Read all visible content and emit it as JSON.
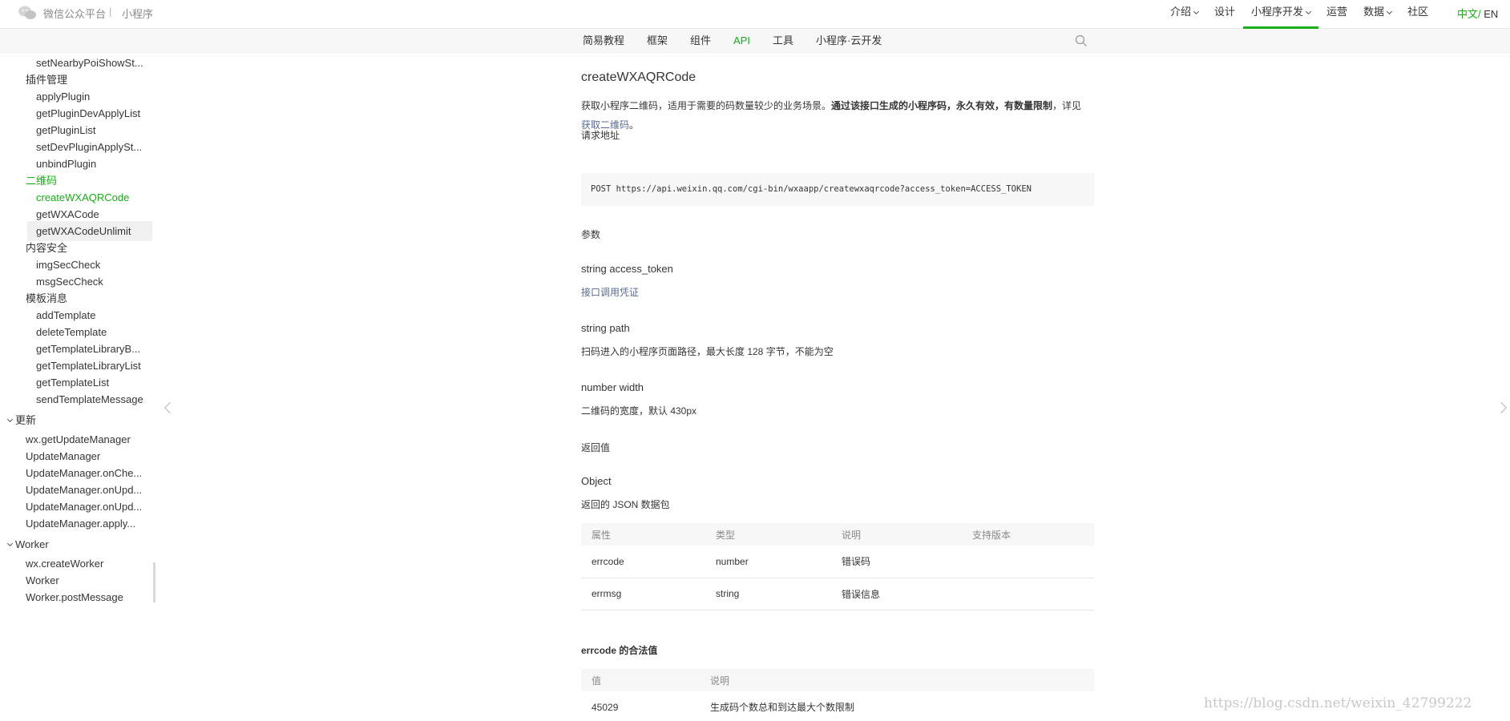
{
  "header": {
    "brand": "微信公众平台",
    "separator": "|",
    "sub_brand": "小程序",
    "nav": [
      {
        "label": "介绍",
        "dropdown": true
      },
      {
        "label": "设计",
        "dropdown": false
      },
      {
        "label": "小程序开发",
        "dropdown": true,
        "active": true
      },
      {
        "label": "运营",
        "dropdown": false
      },
      {
        "label": "数据",
        "dropdown": true
      },
      {
        "label": "社区",
        "dropdown": false
      }
    ],
    "lang_zh": "中文",
    "lang_sep": "/",
    "lang_en": "EN",
    "accent_color": "#1aad19"
  },
  "subnav": {
    "tabs": [
      "简易教程",
      "框架",
      "组件",
      "API",
      "工具",
      "小程序·云开发"
    ],
    "active_tab": "API"
  },
  "sidebar": {
    "items": [
      {
        "label": "setNearbyPoiShowSt...",
        "level": 3
      },
      {
        "label": "插件管理",
        "level": 2
      },
      {
        "label": "applyPlugin",
        "level": 3
      },
      {
        "label": "getPluginDevApplyList",
        "level": 3
      },
      {
        "label": "getPluginList",
        "level": 3
      },
      {
        "label": "setDevPluginApplySt...",
        "level": 3
      },
      {
        "label": "unbindPlugin",
        "level": 3
      },
      {
        "label": "二维码",
        "level": 2,
        "green": true
      },
      {
        "label": "createWXAQRCode",
        "level": 3,
        "green": true
      },
      {
        "label": "getWXACode",
        "level": 3
      },
      {
        "label": "getWXACodeUnlimit",
        "level": 3,
        "selected": true
      },
      {
        "label": "内容安全",
        "level": 2
      },
      {
        "label": "imgSecCheck",
        "level": 3
      },
      {
        "label": "msgSecCheck",
        "level": 3
      },
      {
        "label": "模板消息",
        "level": 2
      },
      {
        "label": "addTemplate",
        "level": 3
      },
      {
        "label": "deleteTemplate",
        "level": 3
      },
      {
        "label": "getTemplateLibraryB...",
        "level": 3
      },
      {
        "label": "getTemplateLibraryList",
        "level": 3
      },
      {
        "label": "getTemplateList",
        "level": 3
      },
      {
        "label": "sendTemplateMessage",
        "level": 3
      },
      {
        "label": "更新",
        "level": 1
      },
      {
        "label": "wx.getUpdateManager",
        "level": 2
      },
      {
        "label": "UpdateManager",
        "level": 2
      },
      {
        "label": "UpdateManager.onChe...",
        "level": 2
      },
      {
        "label": "UpdateManager.onUpd...",
        "level": 2
      },
      {
        "label": "UpdateManager.onUpd...",
        "level": 2
      },
      {
        "label": "UpdateManager.apply...",
        "level": 2
      },
      {
        "label": "Worker",
        "level": 1
      },
      {
        "label": "wx.createWorker",
        "level": 2
      },
      {
        "label": "Worker",
        "level": 2
      },
      {
        "label": "Worker.postMessage",
        "level": 2
      }
    ]
  },
  "main": {
    "title": "createWXAQRCode",
    "desc_1": "获取小程序二维码，适用于需要的码数量较少的业务场景。",
    "desc_bold": "通过该接口生成的小程序码，永久有效，有数量限制",
    "desc_2": "，详见",
    "desc_link": "获取二维码",
    "desc_end": "。",
    "request_label": "请求地址",
    "request_code": "POST https://api.weixin.qq.com/cgi-bin/wxaapp/createwxaqrcode?access_token=ACCESS_TOKEN",
    "params_label": "参数",
    "params": [
      {
        "name": "string access_token",
        "desc": "接口调用凭证",
        "link": true
      },
      {
        "name": "string path",
        "desc": "扫码进入的小程序页面路径，最大长度 128 字节，不能为空",
        "link": false
      },
      {
        "name": "number width",
        "desc": "二维码的宽度，默认 430px",
        "link": false
      }
    ],
    "return_label": "返回值",
    "return_type": "Object",
    "return_desc": "返回的 JSON 数据包",
    "return_table": {
      "headers": [
        "属性",
        "类型",
        "说明",
        "支持版本"
      ],
      "rows": [
        [
          "errcode",
          "number",
          "错误码",
          ""
        ],
        [
          "errmsg",
          "string",
          "错误信息",
          ""
        ]
      ]
    },
    "errcode_title": "errcode 的合法值",
    "errcode_table": {
      "headers": [
        "值",
        "说明"
      ],
      "rows": [
        [
          "45029",
          "生成码个数总和到达最大个数限制"
        ]
      ]
    }
  },
  "watermark": "https://blog.csdn.net/weixin_42799222"
}
